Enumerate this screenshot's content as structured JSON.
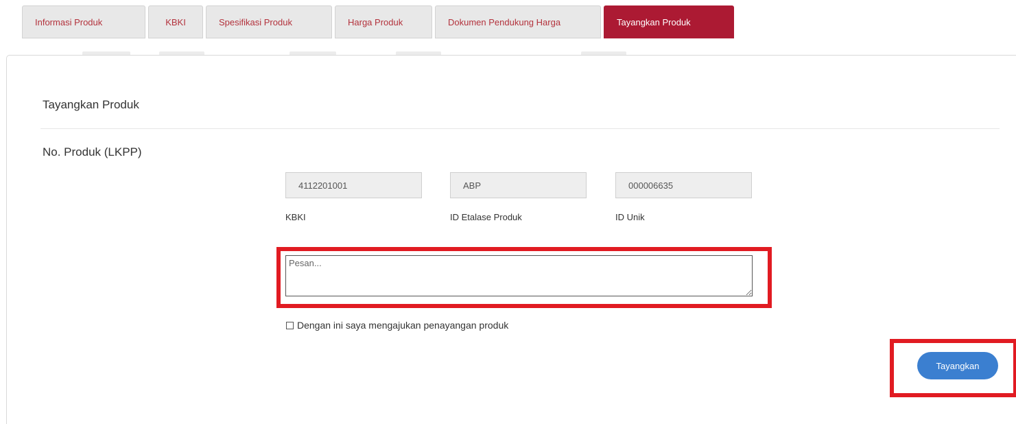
{
  "tabs": [
    {
      "label": "Informasi Produk",
      "active": false
    },
    {
      "label": "KBKI",
      "active": false
    },
    {
      "label": "Spesifikasi Produk",
      "active": false
    },
    {
      "label": "Harga Produk",
      "active": false
    },
    {
      "label": "Dokumen Pendukung Harga",
      "active": false
    },
    {
      "label": "Tayangkan Produk",
      "active": true
    }
  ],
  "section": {
    "title": "Tayangkan Produk",
    "product_number_label": "No. Produk (LKPP)"
  },
  "product_number": {
    "kbki": {
      "value": "4112201001",
      "label": "KBKI"
    },
    "etalase": {
      "value": "ABP",
      "label": "ID Etalase Produk"
    },
    "unik": {
      "value": "000006635",
      "label": "ID Unik"
    }
  },
  "message": {
    "placeholder": "Pesan...",
    "value": ""
  },
  "agreement": {
    "label": "Dengan ini saya mengajukan penayangan produk",
    "checked": false
  },
  "submit_label": "Tayangkan",
  "colors": {
    "active_tab": "#ac1a33",
    "tab_text": "#b3323c",
    "primary_button": "#3b7fd0",
    "highlight": "#e11b22"
  }
}
